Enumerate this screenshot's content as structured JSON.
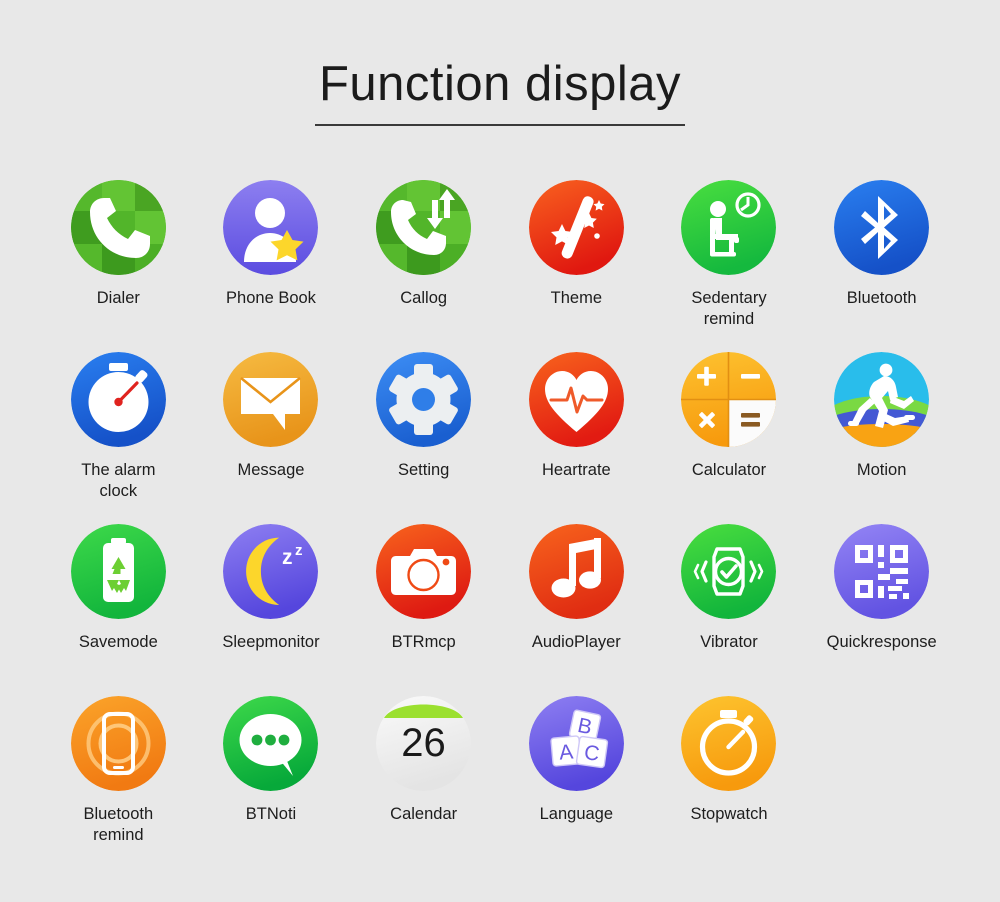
{
  "page": {
    "title": "Function display",
    "background_color": "#e8e8e8",
    "title_color": "#1b1b1b",
    "columns": 6,
    "rows": 4
  },
  "icons": [
    {
      "label": "Dialer",
      "icon_name": "phone-handset-icon",
      "color": "#4caf26"
    },
    {
      "label": "Phone Book",
      "icon_name": "contact-star-icon",
      "color": "#6a5ae0"
    },
    {
      "label": "Callog",
      "icon_name": "call-log-arrows-icon",
      "color": "#4caf26"
    },
    {
      "label": "Theme",
      "icon_name": "magic-wand-icon",
      "color": "#f0441a"
    },
    {
      "label": "Sedentary\nremind",
      "icon_name": "sedentary-person-icon",
      "color": "#2fc23c"
    },
    {
      "label": "Bluetooth",
      "icon_name": "bluetooth-icon",
      "color": "#1565dd"
    },
    {
      "label": "The alarm\nclock",
      "icon_name": "alarm-stopwatch-icon",
      "color": "#1565dd"
    },
    {
      "label": "Message",
      "icon_name": "envelope-bubble-icon",
      "color": "#efa827"
    },
    {
      "label": "Setting",
      "icon_name": "gear-icon",
      "color": "#1f6fd8"
    },
    {
      "label": "Heartrate",
      "icon_name": "heart-pulse-icon",
      "color": "#ef4a15"
    },
    {
      "label": "Calculator",
      "icon_name": "calculator-icon",
      "color": "#fbaa17"
    },
    {
      "label": "Motion",
      "icon_name": "running-person-icon",
      "color": "#29bdeb"
    },
    {
      "label": "Savemode",
      "icon_name": "battery-recycle-icon",
      "color": "#2fbd3c"
    },
    {
      "label": "Sleepmonitor",
      "icon_name": "moon-zz-icon",
      "color": "#6a5ae0"
    },
    {
      "label": "BTRmcp",
      "icon_name": "camera-icon",
      "color": "#ef4a15"
    },
    {
      "label": "AudioPlayer",
      "icon_name": "music-note-icon",
      "color": "#ef5116"
    },
    {
      "label": "Vibrator",
      "icon_name": "vibrating-watch-icon",
      "color": "#2fc23c"
    },
    {
      "label": "Quickresponse",
      "icon_name": "qr-code-icon",
      "color": "#7a66e0"
    },
    {
      "label": "Bluetooth\nremind",
      "icon_name": "phone-ring-icon",
      "color": "#f7901e"
    },
    {
      "label": "BTNoti",
      "icon_name": "chat-bubble-dots-icon",
      "color": "#16b83c"
    },
    {
      "label": "Calendar",
      "icon_name": "calendar-26-icon",
      "color": "#f2f2f2",
      "day": "26"
    },
    {
      "label": "Language",
      "icon_name": "abc-blocks-icon",
      "color": "#6a5ae0"
    },
    {
      "label": "Stopwatch",
      "icon_name": "stopwatch-icon",
      "color": "#fbaa17"
    }
  ]
}
